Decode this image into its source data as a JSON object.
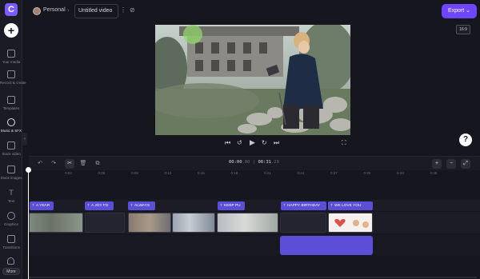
{
  "sidebar": {
    "logo": "C",
    "add": "+",
    "items": [
      {
        "label": "Your media"
      },
      {
        "label": "Record & create"
      },
      {
        "label": "Templates"
      },
      {
        "label": "Music & SFX"
      },
      {
        "label": "Stock video"
      },
      {
        "label": "Stock images"
      },
      {
        "label": "Text"
      },
      {
        "label": "Graphics"
      },
      {
        "label": "Transitions"
      }
    ],
    "more": "More"
  },
  "header": {
    "workspace": "Personal",
    "separator": "›",
    "title": "Untitled video",
    "title_menu": "⋮",
    "sync_icon": "⊘",
    "export_label": "Export ⌄",
    "accent": "#6c47ff"
  },
  "preview": {
    "aspect_ratio": "16:9",
    "help": "?"
  },
  "player": {
    "skip_back": "⏮",
    "rewind5": "↺",
    "play": "▶",
    "forward5": "↻",
    "skip_forward": "⏭",
    "fullscreen": "⛶"
  },
  "timeline": {
    "timecode_current": "00:00",
    "timecode_current_frames": ".00",
    "timecode_sep": "|",
    "timecode_total": "00:31",
    "timecode_total_frames": ".29",
    "ruler_ticks": [
      "0:03",
      "0:06",
      "0:09",
      "0:12",
      "0:15",
      "0:18",
      "0:21",
      "0:24",
      "0:27",
      "0:30",
      "0:33",
      "0:36"
    ],
    "tools": {
      "undo": "↶",
      "redo": "↷",
      "split": "✂",
      "delete": "🗑",
      "duplicate": "⧉",
      "zoom_in": "+",
      "zoom_out": "−",
      "fit": "⤢"
    },
    "text_clips": [
      {
        "label": "A YEAR"
      },
      {
        "label": "A JOY FO"
      },
      {
        "label": "ALWAYS"
      },
      {
        "label": "KEEP PU"
      },
      {
        "label": "HAPPY BIRTHDAY"
      },
      {
        "label": "WE LOVE YOU"
      }
    ]
  }
}
